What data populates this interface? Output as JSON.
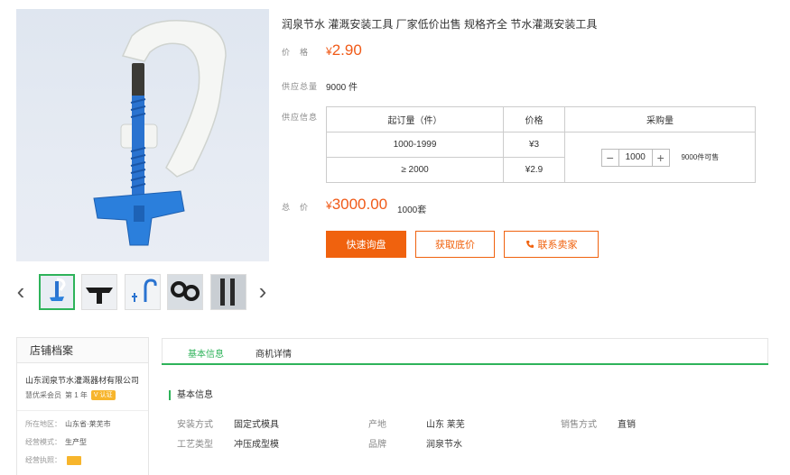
{
  "product": {
    "title": "润泉节水 灌溉安装工具 厂家低价出售 规格齐全 节水灌溉安装工具",
    "price_label": "价　格",
    "price_currency": "¥",
    "price_value": "2.90",
    "supply_label": "供应总量",
    "supply_value": "9000 件",
    "info_label": "供应信息",
    "total_label": "总　价",
    "total_currency": "¥",
    "total_value": "3000.00",
    "total_unit": "1000套"
  },
  "tiers": {
    "headers": [
      "起订量（件）",
      "价格",
      "采购量"
    ],
    "rows": [
      {
        "qty": "1000-1999",
        "price": "¥3"
      },
      {
        "qty": "≥ 2000",
        "price": "¥2.9"
      }
    ],
    "quantity": "1000",
    "minus": "−",
    "plus": "+",
    "available": "9000件可售"
  },
  "actions": {
    "inquiry": "快速询盘",
    "get_price": "获取底价",
    "contact": "联系卖家"
  },
  "thumbnails": {
    "prev": "‹",
    "next": "›",
    "count": 5,
    "active_index": 0
  },
  "shop": {
    "header": "店铺档案",
    "name": "山东润泉节水灌溉器材有限公司",
    "member": "慧优采会员",
    "years": "第 1 年",
    "auth": "V 认证",
    "rows": [
      {
        "k": "所在地区：",
        "v": "山东省·莱芜市"
      },
      {
        "k": "经营模式：",
        "v": "生产型"
      },
      {
        "k": "经营执照：",
        "v": ""
      }
    ]
  },
  "detail": {
    "tabs": [
      "基本信息",
      "商机详情"
    ],
    "section_title": "基本信息",
    "attributes": [
      {
        "k": "安装方式",
        "v": "固定式模具"
      },
      {
        "k": "产地",
        "v": "山东 莱芜"
      },
      {
        "k": "销售方式",
        "v": "直销"
      },
      {
        "k": "工艺类型",
        "v": "冲压成型模"
      },
      {
        "k": "品牌",
        "v": "润泉节水"
      }
    ]
  },
  "colors": {
    "accent": "#f0620e",
    "price": "#f05a18",
    "tab_active": "#2eb35a"
  }
}
